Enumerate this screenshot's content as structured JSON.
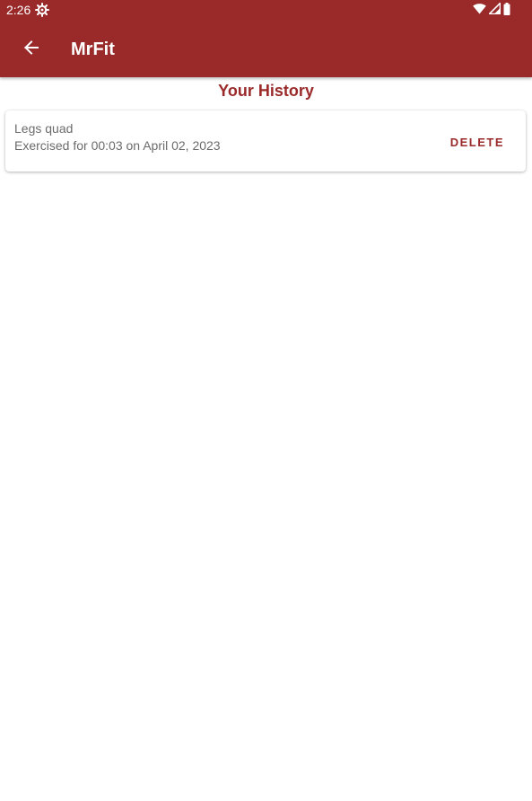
{
  "status_bar": {
    "time": "2:26",
    "icons": [
      "settings-gear-icon",
      "wifi-icon",
      "cell-signal-icon",
      "battery-icon"
    ]
  },
  "app_bar": {
    "title": "MrFit",
    "back_icon": "arrow-back-icon"
  },
  "page": {
    "title": "Your History"
  },
  "history": [
    {
      "name": "Legs quad",
      "detail": "Exercised for 00:03 on April 02, 2023",
      "action_label": "DELETE"
    }
  ],
  "colors": {
    "primary": "#9a2a2a",
    "text_secondary": "#6b6b6b",
    "background": "#ffffff"
  }
}
